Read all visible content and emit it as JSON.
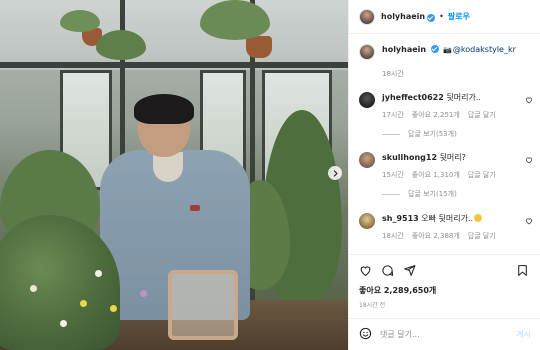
{
  "post": {
    "username": "holyhaein",
    "follow_label": "팔로우",
    "caption_username": "holyhaein",
    "caption_mention": "@kodakstyle_kr",
    "caption_time": "18시간",
    "likes": "좋아요 2,289,650개",
    "posted_time": "18시간 전"
  },
  "comments": [
    {
      "username": "jyheffect0622",
      "text": "뒷머리가..",
      "time": "17시간",
      "likes": "좋아요 2,251개",
      "reply": "답글 달기",
      "view_replies": "답글 보기(53개)"
    },
    {
      "username": "skullhong12",
      "text": "뒷머리?",
      "time": "15시간",
      "likes": "좋아요 1,310개",
      "reply": "답글 달기",
      "view_replies": "답글 보기(15개)"
    },
    {
      "username": "sh_9513",
      "text": "오빠 뒷머리가..",
      "time": "18시간",
      "likes": "좋아요 2,388개",
      "reply": "답글 달기"
    }
  ],
  "comment_input": {
    "placeholder": "댓글 달기...",
    "post_label": "게시"
  },
  "colors": {
    "follow": "#0095f6",
    "verified": "#3897f0",
    "muted": "#8e8e8e",
    "post_disabled": "#b2dffc"
  },
  "icons": [
    "verified-icon",
    "camera-icon",
    "heart-icon",
    "comment-icon",
    "share-icon",
    "bookmark-icon",
    "smiley-icon",
    "chevron-right-icon"
  ]
}
